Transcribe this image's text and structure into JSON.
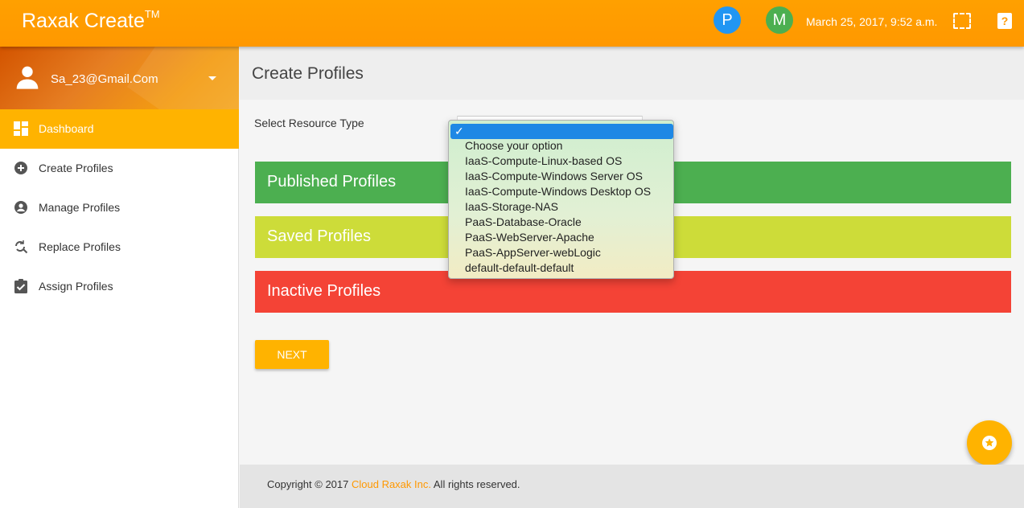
{
  "header": {
    "brand": "Raxak Create",
    "trademark": "TM",
    "avatars": [
      "P",
      "M"
    ],
    "datetime": "March 25, 2017, 9:52 a.m.",
    "help_glyph": "?",
    "icons": [
      "fullscreen-icon",
      "help-icon"
    ]
  },
  "user": {
    "email": "Sa_23@Gmail.Com",
    "icon": "person-icon"
  },
  "sidebar": {
    "items": [
      {
        "label": "Dashboard",
        "icon": "dashboard-icon",
        "active": true
      },
      {
        "label": "Create Profiles",
        "icon": "add-circle-icon"
      },
      {
        "label": "Manage Profiles",
        "icon": "account-circle-icon"
      },
      {
        "label": "Replace Profiles",
        "icon": "find-replace-icon"
      },
      {
        "label": "Assign Profiles",
        "icon": "assignment-icon"
      }
    ]
  },
  "main": {
    "title": "Create Profiles",
    "field_label": "Select Resource Type",
    "sections": [
      {
        "label": "Published Profiles",
        "color": "#4caf50"
      },
      {
        "label": "Saved Profiles",
        "color": "#cddc39"
      },
      {
        "label": "Inactive Profiles",
        "color": "#f44336"
      }
    ],
    "next_label": "NEXT"
  },
  "dropdown": {
    "selected_check": "✓",
    "options": [
      "Choose your option",
      "IaaS-Compute-Linux-based OS",
      "IaaS-Compute-Windows Server OS",
      "IaaS-Compute-Windows Desktop OS",
      "IaaS-Storage-NAS",
      "PaaS-Database-Oracle",
      "PaaS-WebServer-Apache",
      "PaaS-AppServer-webLogic",
      "default-default-default"
    ]
  },
  "footer": {
    "prefix": "Copyright © 2017 ",
    "link": "Cloud Raxak Inc.",
    "suffix": " All rights reserved."
  },
  "colors": {
    "header": "#ff9800",
    "accent": "#ffb300",
    "dropdown_highlight": "#1e88e5"
  }
}
